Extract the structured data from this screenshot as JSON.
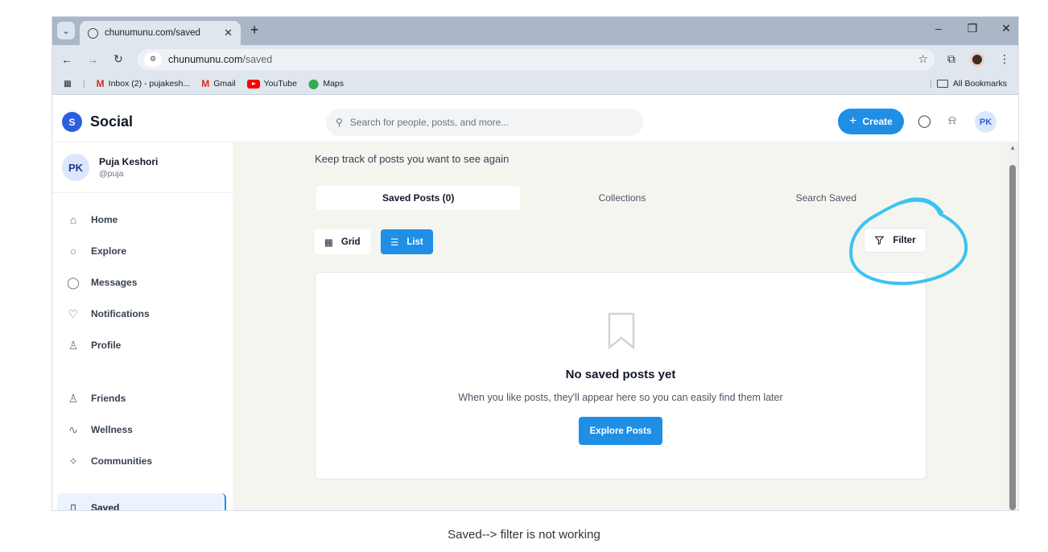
{
  "browser": {
    "tab_title": "chunumunu.com/saved",
    "url_host": "chunumunu.com",
    "url_path": "/saved",
    "bookmarks": [
      "Inbox (2) - pujakesh...",
      "Gmail",
      "YouTube",
      "Maps"
    ],
    "all_bookmarks": "All Bookmarks"
  },
  "app": {
    "logo_letter": "S",
    "logo_text": "Social",
    "search_placeholder": "Search for people, posts, and more...",
    "create_label": "Create",
    "avatar_initials": "PK"
  },
  "user": {
    "initials": "PK",
    "name": "Puja Keshori",
    "handle": "@puja"
  },
  "sidebar": {
    "items": [
      {
        "label": "Home"
      },
      {
        "label": "Explore"
      },
      {
        "label": "Messages"
      },
      {
        "label": "Notifications"
      },
      {
        "label": "Profile"
      },
      {
        "label": "Friends"
      },
      {
        "label": "Wellness"
      },
      {
        "label": "Communities"
      },
      {
        "label": "Saved"
      }
    ]
  },
  "main": {
    "subtitle": "Keep track of posts you want to see again",
    "tabs": [
      "Saved Posts (0)",
      "Collections",
      "Search Saved"
    ],
    "view_grid": "Grid",
    "view_list": "List",
    "filter_label": "Filter",
    "empty_title": "No saved posts yet",
    "empty_desc": "When you like posts, they'll appear here so you can easily find them later",
    "explore_button": "Explore Posts"
  },
  "caption": "Saved--> filter is not working",
  "colors": {
    "accent": "#1f8fe6",
    "annotation": "#3cc3f0"
  }
}
